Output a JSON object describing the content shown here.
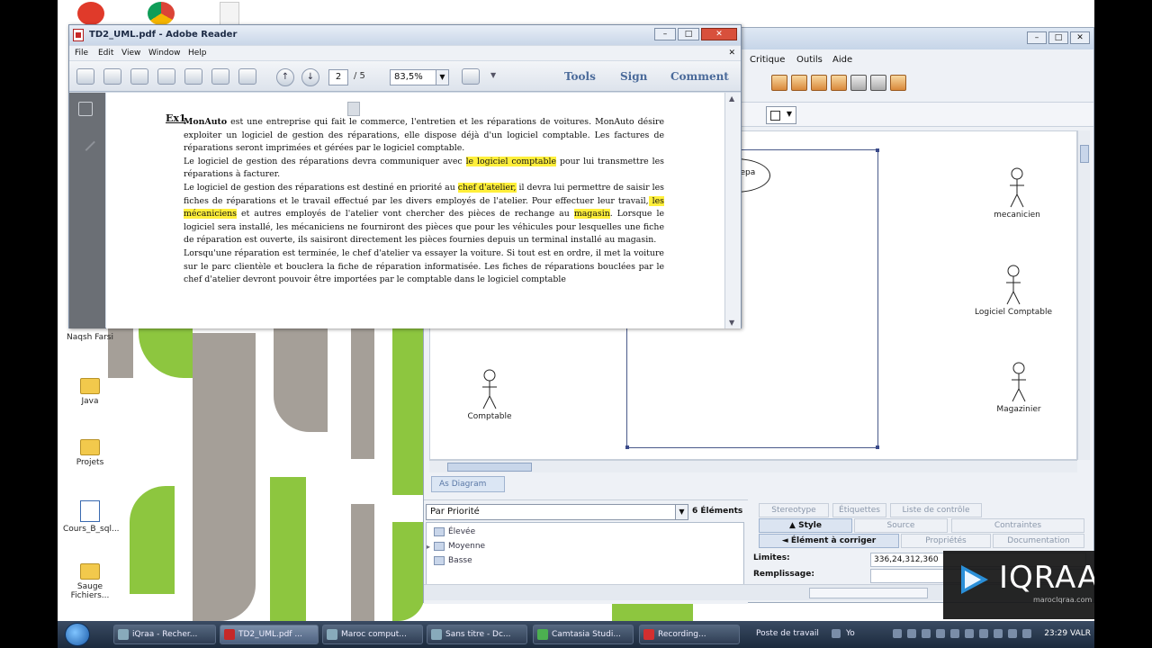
{
  "reader": {
    "title": "TD2_UML.pdf - Adobe Reader",
    "menu": [
      "File",
      "Edit",
      "View",
      "Window",
      "Help"
    ],
    "page_current": "2",
    "page_total": "/ 5",
    "zoom": "83,5%",
    "actions": [
      "Tools",
      "Sign",
      "Comment"
    ],
    "heading": "Ex1",
    "doc": {
      "p1_brand": "MonAuto",
      "p1": " est une entreprise  qui fait le commerce, l'entretien et les réparations de voitures. MonAuto désire exploiter un logiciel de gestion des réparations, elle dispose déjà d'un logiciel comptable. Les factures de réparations seront  imprimées et gérées par le logiciel comptable.",
      "p2_a": "Le logiciel de gestion des réparations devra communiquer avec ",
      "p2_hl": "le logiciel  comptable",
      "p2_b": " pour lui transmettre les réparations à facturer.",
      "p3_a": "Le logiciel de gestion des réparations est destiné en priorité au ",
      "p3_hl1": "chef d'atelier,",
      "p3_b": " il devra lui permettre de saisir les fiches de réparations et le travail effectué par les divers employés de l'atelier. Pour effectuer leur travail,",
      "p3_hl2": " les mécaniciens",
      "p3_c": " et autres employés de l'atelier vont chercher des pièces de rechange au ",
      "p3_hl3": "magasin",
      "p3_d": ". Lorsque le logiciel sera  installé, les mécaniciens ne fourniront des pièces que pour les véhicules pour lesquelles une fiche de réparation est ouverte, ils saisiront directement les pièces fournies depuis un terminal installé au magasin.",
      "p4": "Lorsqu'une réparation est terminée, le chef d'atelier va essayer  la voiture. Si tout est en ordre, il met la voiture sur le parc clientèle et bouclera la fiche de réparation informatisée. Les fiches de réparations bouclées par le chef d'atelier devront pouvoir être importées par le comptable dans le logiciel comptable"
    }
  },
  "argo": {
    "menu_critique": "Critique",
    "menu_outils": "Outils",
    "menu_aide": "Aide",
    "usecase_label": "repa",
    "actors": {
      "mecanicien": "mecanicien",
      "logiciel": "Logiciel Comptable",
      "comptable": "Comptable",
      "magazinier": "Magazinier"
    },
    "diagram_tab": "As Diagram",
    "todo": {
      "sort": "Par Priorité",
      "count": "6 Éléments",
      "items": [
        "Élevée",
        "Moyenne",
        "Basse"
      ]
    },
    "props": {
      "tabs_row1": [
        "Stereotype",
        "Étiquettes",
        "Liste de contrôle"
      ],
      "tabs_row2": [
        "▲ Style",
        "Source",
        "Contraintes"
      ],
      "tabs_row3": [
        "◄ Élément à corriger",
        "Propriétés",
        "Documentation"
      ],
      "limites_label": "Limites:",
      "limites_value": "336,24,312,360",
      "remplissage_label": "Remplissage:"
    }
  },
  "desktop": {
    "icons": [
      "Naqsh Farsi",
      "Java",
      "Projets",
      "Cours_B_sql...",
      "Sauge Fichiers..."
    ]
  },
  "taskbar": {
    "tasks": [
      "iQraa - Recher...",
      "TD2_UML.pdf ...",
      "Maroc comput...",
      "Sans titre - Dc...",
      "Camtasia Studi...",
      "Recording..."
    ],
    "tray_label": "Poste de travail",
    "tray_label2": "Yo",
    "clock": "23:29 VALR"
  },
  "logo": {
    "brand": "IQRAA",
    "url": "marocIqraa.com"
  }
}
